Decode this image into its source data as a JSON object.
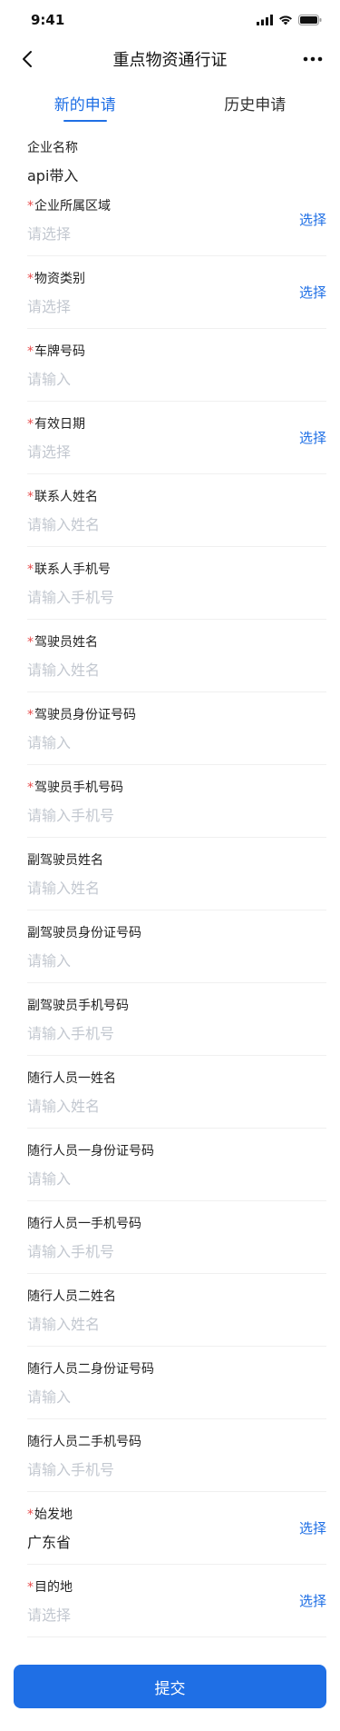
{
  "status_bar": {
    "time": "9:41"
  },
  "nav": {
    "title": "重点物资通行证"
  },
  "tabs": [
    {
      "label": "新的申请",
      "active": true
    },
    {
      "label": "历史申请",
      "active": false
    }
  ],
  "form": {
    "company": {
      "label": "企业名称",
      "value": "api带入"
    },
    "fields": [
      {
        "label": "企业所属区域",
        "required": true,
        "placeholder": "请选择",
        "action": "选择"
      },
      {
        "label": "物资类别",
        "required": true,
        "placeholder": "请选择",
        "action": "选择"
      },
      {
        "label": "车牌号码",
        "required": true,
        "placeholder": "请输入"
      },
      {
        "label": "有效日期",
        "required": true,
        "placeholder": "请选择",
        "action": "选择"
      },
      {
        "label": "联系人姓名",
        "required": true,
        "placeholder": "请输入姓名"
      },
      {
        "label": "联系人手机号",
        "required": true,
        "placeholder": "请输入手机号"
      },
      {
        "label": "驾驶员姓名",
        "required": true,
        "placeholder": "请输入姓名"
      },
      {
        "label": "驾驶员身份证号码",
        "required": true,
        "placeholder": "请输入"
      },
      {
        "label": "驾驶员手机号码",
        "required": true,
        "placeholder": "请输入手机号"
      },
      {
        "label": "副驾驶员姓名",
        "required": false,
        "placeholder": "请输入姓名"
      },
      {
        "label": "副驾驶员身份证号码",
        "required": false,
        "placeholder": "请输入"
      },
      {
        "label": "副驾驶员手机号码",
        "required": false,
        "placeholder": "请输入手机号"
      },
      {
        "label": "随行人员一姓名",
        "required": false,
        "placeholder": "请输入姓名"
      },
      {
        "label": "随行人员一身份证号码",
        "required": false,
        "placeholder": "请输入"
      },
      {
        "label": "随行人员一手机号码",
        "required": false,
        "placeholder": "请输入手机号"
      },
      {
        "label": "随行人员二姓名",
        "required": false,
        "placeholder": "请输入姓名"
      },
      {
        "label": "随行人员二身份证号码",
        "required": false,
        "placeholder": "请输入"
      },
      {
        "label": "随行人员二手机号码",
        "required": false,
        "placeholder": "请输入手机号"
      },
      {
        "label": "始发地",
        "required": true,
        "value": "广东省",
        "action": "选择"
      },
      {
        "label": "目的地",
        "required": true,
        "placeholder": "请选择",
        "action": "选择"
      }
    ]
  },
  "submit": {
    "label": "提交"
  },
  "colors": {
    "accent": "#1f6fe5",
    "required": "#e84a4a",
    "placeholder": "#c3c8d0"
  }
}
